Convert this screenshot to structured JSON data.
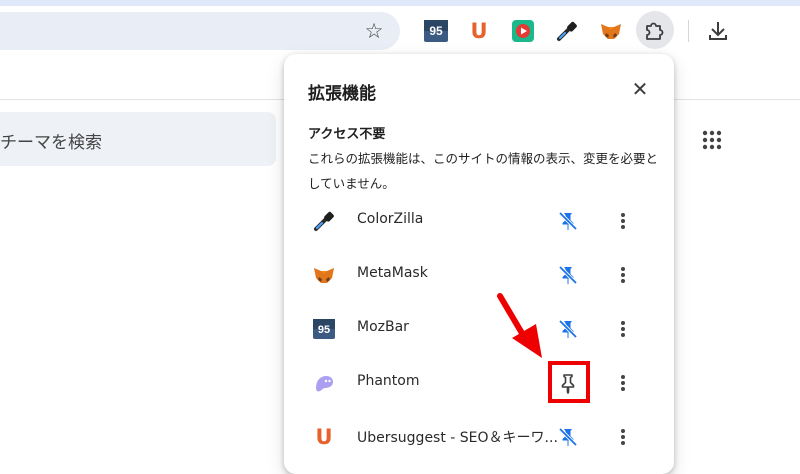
{
  "browser": {
    "toolbar_icons": [
      "star-icon",
      "moz-icon",
      "ubersuggest-icon",
      "video-icon",
      "colorzilla-icon",
      "metamask-icon",
      "extensions-puzzle-icon",
      "download-icon"
    ],
    "moz_badge_text": "95",
    "ubersuggest_letter": "U"
  },
  "page": {
    "theme_search_placeholder": "チーマを検索"
  },
  "popup": {
    "title": "拡張機能",
    "section_title": "アクセス不要",
    "section_desc": "これらの拡張機能は、このサイトの情報の表示、変更を必要としていません。",
    "extensions": [
      {
        "name": "ColorZilla",
        "icon": "colorzilla-icon",
        "pinned": true
      },
      {
        "name": "MetaMask",
        "icon": "metamask-icon",
        "pinned": true
      },
      {
        "name": "MozBar",
        "icon": "moz-icon",
        "pinned": true
      },
      {
        "name": "Phantom",
        "icon": "phantom-icon",
        "pinned": false
      },
      {
        "name": "Ubersuggest - SEO＆キーワ...",
        "icon": "ubersuggest-icon",
        "pinned": true
      }
    ]
  },
  "colors": {
    "accent_blue": "#1a73e8",
    "highlight_red": "#ee0000",
    "ubersuggest_orange": "#e8602c",
    "phantom_purple": "#ab9ff2"
  }
}
